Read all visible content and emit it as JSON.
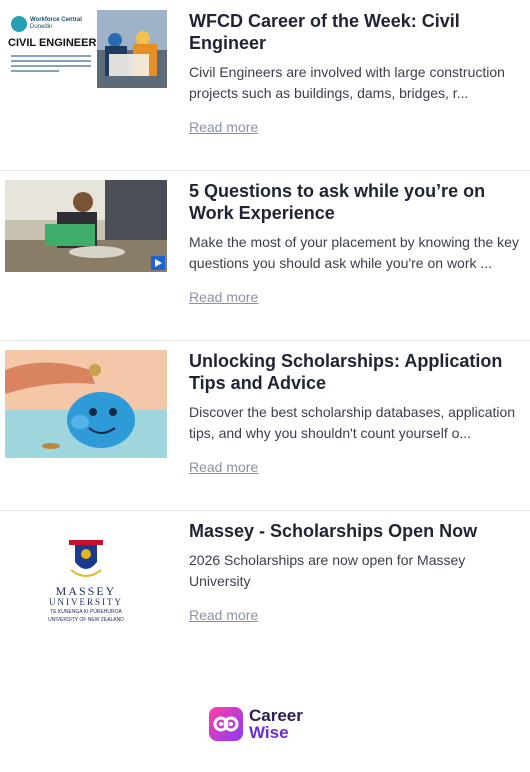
{
  "articles": [
    {
      "title": "WFCD Career of the Week: Civil Engineer",
      "description": "Civil Engineers are involved with large construction projects such as buildings, dams, bridges, r...",
      "link": "Read more",
      "image_text": {
        "brand_line1": "Workforce Central",
        "brand_line2": "Dunedin",
        "heading": "CIVIL ENGINEER"
      }
    },
    {
      "title": "5 Questions to ask while you’re on Work Experience",
      "description": "Make the most of your placement by knowing the key questions you should ask while you're on work ...",
      "link": "Read more"
    },
    {
      "title": "Unlocking Scholarships: Application Tips and Advice",
      "description": "Discover the best scholarship databases, application tips, and why you shouldn't count yourself o...",
      "link": "Read more"
    },
    {
      "title": "Massey - Scholarships Open Now",
      "description": "2026 Scholarships are now open for Massey University",
      "link": "Read more",
      "logo_text": {
        "line1": "MASSEY",
        "line2": "UNIVERSITY",
        "line3": "TE KUNENGA KI PŪREHUROA",
        "line4": "UNIVERSITY OF NEW ZEALAND"
      }
    }
  ],
  "footer": {
    "brand_line1": "Career",
    "brand_line2": "Wise"
  },
  "colors": {
    "title": "#1f2433",
    "link": "#8a93a6",
    "divider": "#e6e6e6",
    "brand_pink": "#ff3ea5",
    "brand_purple": "#8b3cf7"
  }
}
